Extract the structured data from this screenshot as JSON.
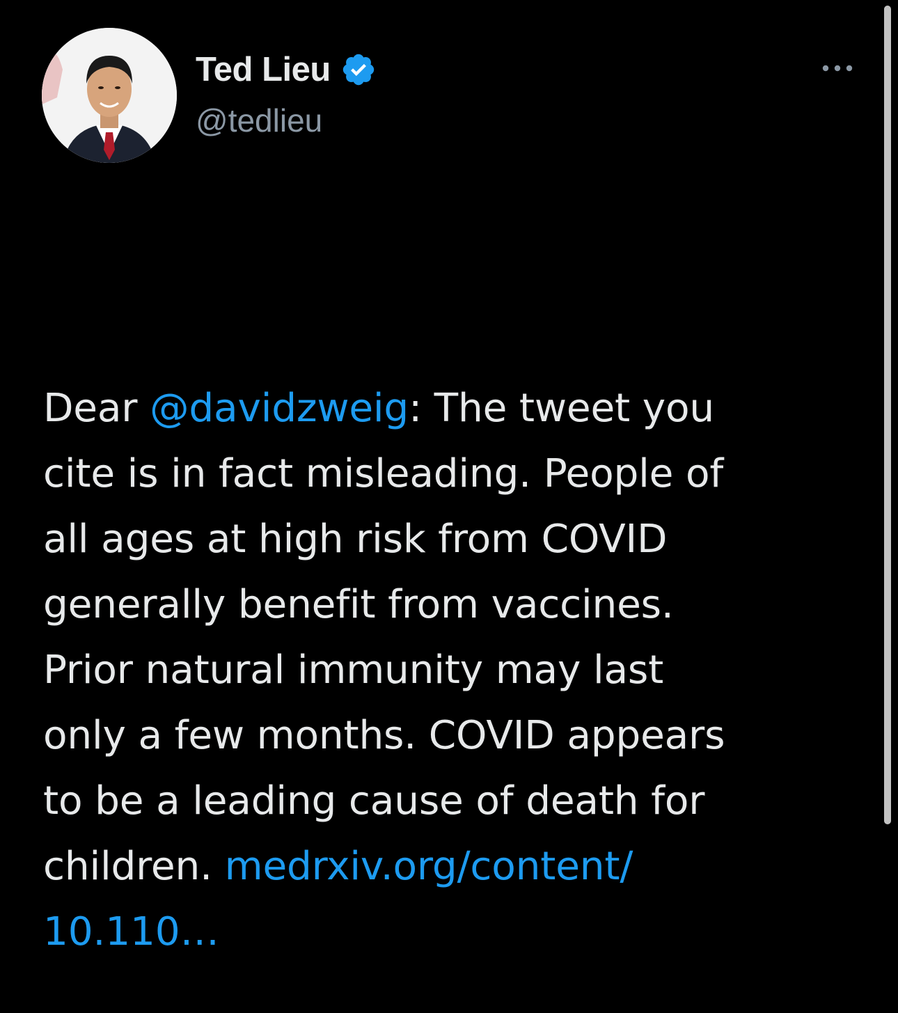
{
  "tweet": {
    "author": {
      "display_name": "Ted Lieu",
      "handle": "@tedlieu",
      "verified": true,
      "avatar_icon": "profile-photo"
    },
    "more_icon": "more-horizontal-icon",
    "text_parts": {
      "line1_prefix": "Dear ",
      "mention": "@davidzweig",
      "line1_suffix": ": The tweet you",
      "line2": "cite is in fact misleading. People of",
      "line3": "all ages at high risk from COVID",
      "line4": "generally benefit from vaccines.",
      "line5": "Prior natural immunity may last",
      "line6": "only a few months. COVID appears",
      "line7": "to be a leading cause of death for",
      "line8_prefix": "children. ",
      "link_line8": "medrxiv.org/content/",
      "link_line9": "10.110…"
    }
  },
  "colors": {
    "background": "#000000",
    "text": "#e7e9ea",
    "secondary_text": "#8b98a5",
    "link": "#1d9bf0",
    "verified_badge": "#1d9bf0"
  }
}
